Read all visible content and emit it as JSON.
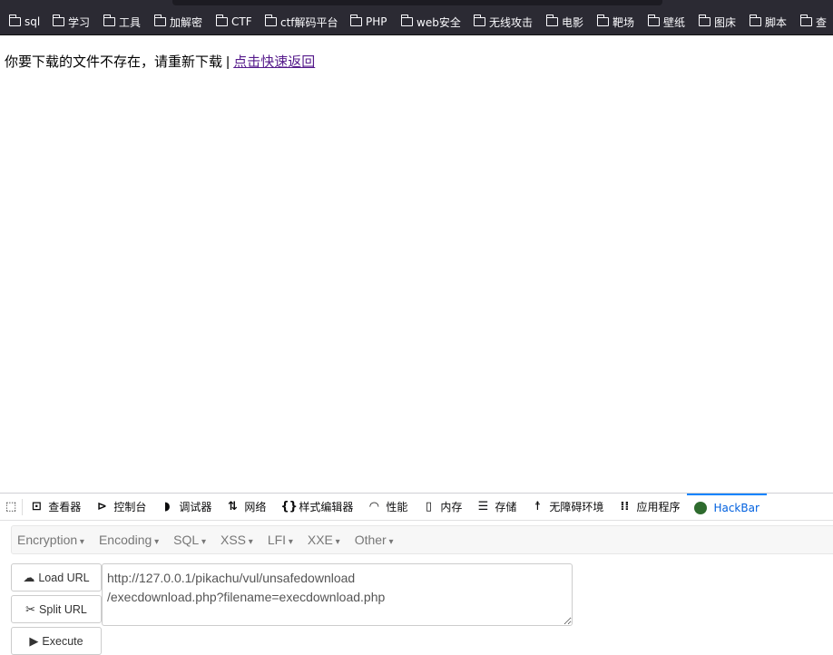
{
  "bookmarks": [
    "sql",
    "学习",
    "工具",
    "加解密",
    "CTF",
    "ctf解码平台",
    "PHP",
    "web安全",
    "无线攻击",
    "电影",
    "靶场",
    "壁纸",
    "图床",
    "脚本",
    "查"
  ],
  "page": {
    "message": "你要下载的文件不存在，请重新下载 | ",
    "link": "点击快速返回"
  },
  "devtools": {
    "tabs": [
      {
        "label": "查看器",
        "icon": "inspector-icon"
      },
      {
        "label": "控制台",
        "icon": "console-icon"
      },
      {
        "label": "调试器",
        "icon": "debugger-icon"
      },
      {
        "label": "网络",
        "icon": "network-icon"
      },
      {
        "label": "样式编辑器",
        "icon": "style-editor-icon"
      },
      {
        "label": "性能",
        "icon": "performance-icon"
      },
      {
        "label": "内存",
        "icon": "memory-icon"
      },
      {
        "label": "存储",
        "icon": "storage-icon"
      },
      {
        "label": "无障碍环境",
        "icon": "accessibility-icon"
      },
      {
        "label": "应用程序",
        "icon": "application-icon"
      },
      {
        "label": "HackBar",
        "icon": "hackbar-icon",
        "active": true
      }
    ]
  },
  "hackbar": {
    "menu": [
      "Encryption",
      "Encoding",
      "SQL",
      "XSS",
      "LFI",
      "XXE",
      "Other"
    ],
    "load_url": "Load URL",
    "split_url": "Split URL",
    "execute": "Execute",
    "url": "http://127.0.0.1/pikachu/vul/unsafedownload\n/execdownload.php?filename=execdownload.php"
  },
  "colors": {
    "accent": "#0a84ff",
    "link": "#551a8b",
    "toolbar": "#2b2a33"
  }
}
